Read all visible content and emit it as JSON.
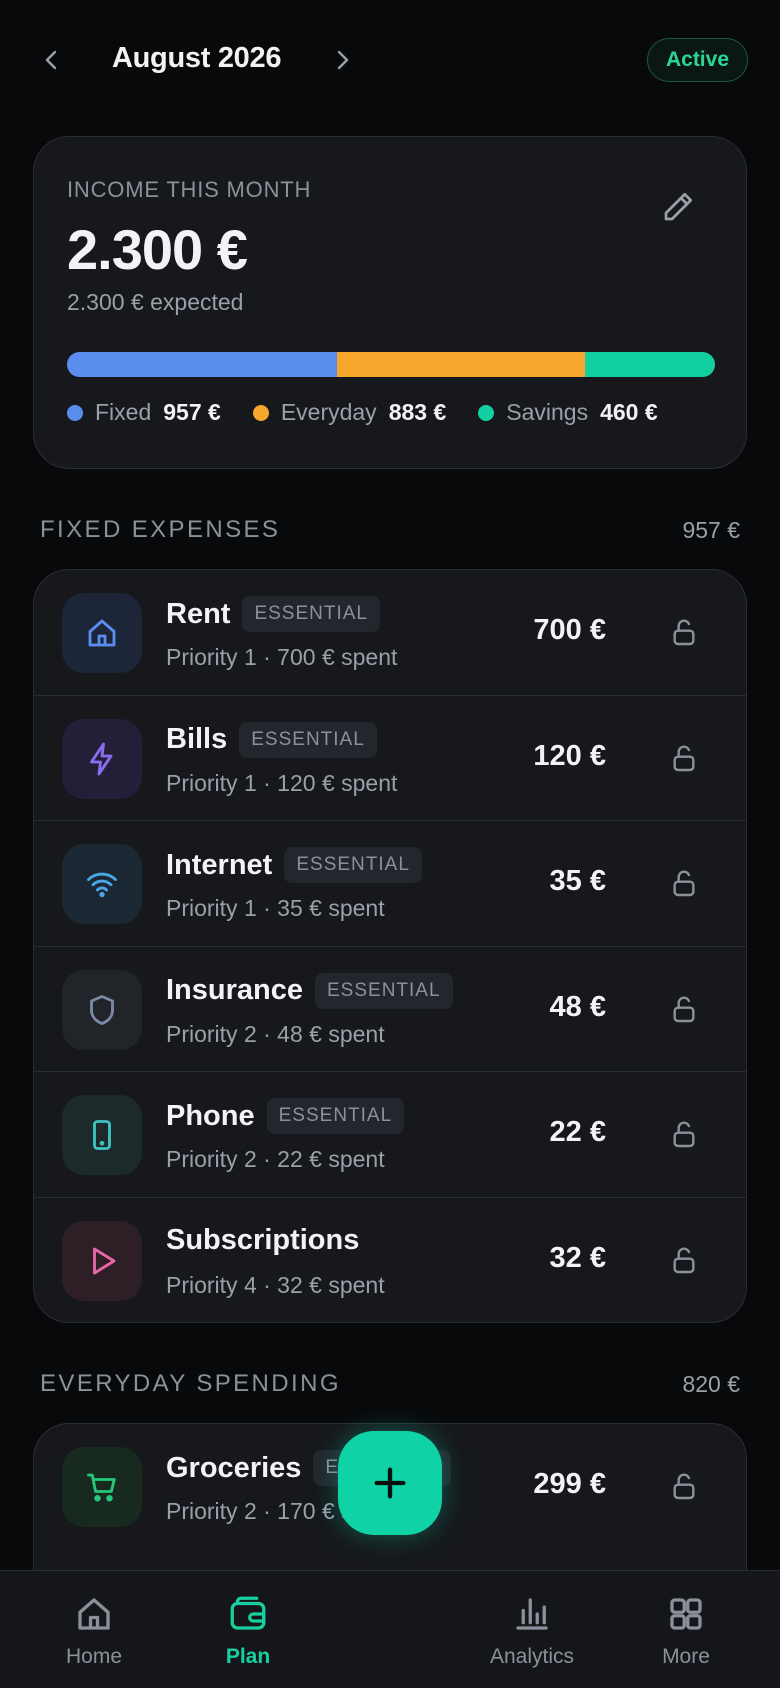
{
  "header": {
    "month": "August 2026",
    "status": "Active"
  },
  "income": {
    "label": "INCOME THIS MONTH",
    "amount": "2.300 €",
    "expected": "2.300 € expected",
    "allocation": [
      {
        "name": "Fixed",
        "value": "957 €",
        "amount": 957,
        "color": "#5b8def"
      },
      {
        "name": "Everyday",
        "value": "883 €",
        "amount": 883,
        "color": "#f5a62b"
      },
      {
        "name": "Savings",
        "value": "460 €",
        "amount": 460,
        "color": "#12cfa1"
      }
    ]
  },
  "fixed": {
    "title": "FIXED EXPENSES",
    "total": "957 €",
    "items": [
      {
        "name": "Rent",
        "tag": "ESSENTIAL",
        "sub": "Priority 1 · 700 € spent",
        "amount": "700 €",
        "icon": "home-icon",
        "tint": "#1d2638",
        "color": "#5b8def"
      },
      {
        "name": "Bills",
        "tag": "ESSENTIAL",
        "sub": "Priority 1 · 120 € spent",
        "amount": "120 €",
        "icon": "bolt-icon",
        "tint": "#231f38",
        "color": "#8b6ef0"
      },
      {
        "name": "Internet",
        "tag": "ESSENTIAL",
        "sub": "Priority 1 · 35 € spent",
        "amount": "35 €",
        "icon": "wifi-icon",
        "tint": "#1b2833",
        "color": "#4aa8e8"
      },
      {
        "name": "Insurance",
        "tag": "ESSENTIAL",
        "sub": "Priority 2 · 48 € spent",
        "amount": "48 €",
        "icon": "shield-icon",
        "tint": "#212429",
        "color": "#7a8aa6"
      },
      {
        "name": "Phone",
        "tag": "ESSENTIAL",
        "sub": "Priority 2 · 22 € spent",
        "amount": "22 €",
        "icon": "phone-icon",
        "tint": "#1c2a2c",
        "color": "#3ec3c0"
      },
      {
        "name": "Subscriptions",
        "tag": "",
        "sub": "Priority 4 · 32 € spent",
        "amount": "32 €",
        "icon": "play-icon",
        "tint": "#2e1f27",
        "color": "#e667a6"
      }
    ]
  },
  "everyday": {
    "title": "EVERYDAY SPENDING",
    "total": "820 €",
    "items": [
      {
        "name": "Groceries",
        "tag": "ESSENTIAL",
        "sub": "Priority 2 · 170 € spent",
        "amount": "299 €",
        "icon": "cart-icon",
        "tint": "#18291f",
        "color": "#25c87a"
      }
    ]
  },
  "nav": {
    "tabs": [
      {
        "label": "Home",
        "icon": "home-icon"
      },
      {
        "label": "Plan",
        "icon": "wallet-icon",
        "active": true
      },
      {
        "label": "Analytics",
        "icon": "bar-chart-icon"
      },
      {
        "label": "More",
        "icon": "grid-icon"
      }
    ],
    "fab_icon": "plus-icon"
  }
}
